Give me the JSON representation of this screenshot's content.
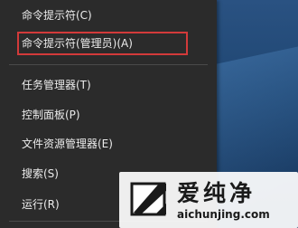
{
  "menu": {
    "items": [
      {
        "label": "命令提示符(C)"
      },
      {
        "label": "命令提示符(管理员)(A)"
      },
      {
        "label": "任务管理器(T)"
      },
      {
        "label": "控制面板(P)"
      },
      {
        "label": "文件资源管理器(E)"
      },
      {
        "label": "搜索(S)"
      },
      {
        "label": "运行(R)"
      }
    ]
  },
  "watermark": {
    "title": "爱纯净",
    "url": "aichunjing.com"
  },
  "colors": {
    "menu_bg": "#2b2b2b",
    "highlight_border": "#d23a3a",
    "desktop": "#1f4672"
  }
}
